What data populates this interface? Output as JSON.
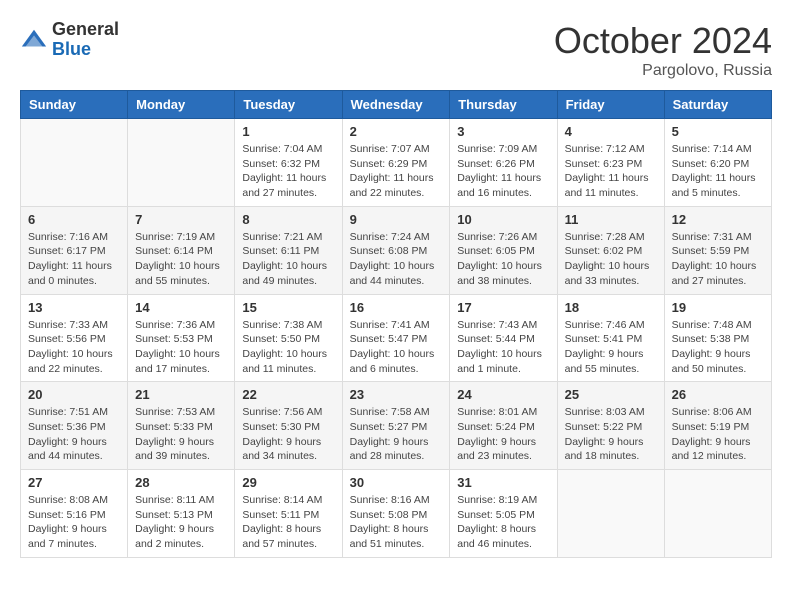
{
  "logo": {
    "general": "General",
    "blue": "Blue"
  },
  "title": {
    "month": "October 2024",
    "location": "Pargolovo, Russia"
  },
  "headers": [
    "Sunday",
    "Monday",
    "Tuesday",
    "Wednesday",
    "Thursday",
    "Friday",
    "Saturday"
  ],
  "weeks": [
    [
      {
        "day": "",
        "sunrise": "",
        "sunset": "",
        "daylight": ""
      },
      {
        "day": "",
        "sunrise": "",
        "sunset": "",
        "daylight": ""
      },
      {
        "day": "1",
        "sunrise": "Sunrise: 7:04 AM",
        "sunset": "Sunset: 6:32 PM",
        "daylight": "Daylight: 11 hours and 27 minutes."
      },
      {
        "day": "2",
        "sunrise": "Sunrise: 7:07 AM",
        "sunset": "Sunset: 6:29 PM",
        "daylight": "Daylight: 11 hours and 22 minutes."
      },
      {
        "day": "3",
        "sunrise": "Sunrise: 7:09 AM",
        "sunset": "Sunset: 6:26 PM",
        "daylight": "Daylight: 11 hours and 16 minutes."
      },
      {
        "day": "4",
        "sunrise": "Sunrise: 7:12 AM",
        "sunset": "Sunset: 6:23 PM",
        "daylight": "Daylight: 11 hours and 11 minutes."
      },
      {
        "day": "5",
        "sunrise": "Sunrise: 7:14 AM",
        "sunset": "Sunset: 6:20 PM",
        "daylight": "Daylight: 11 hours and 5 minutes."
      }
    ],
    [
      {
        "day": "6",
        "sunrise": "Sunrise: 7:16 AM",
        "sunset": "Sunset: 6:17 PM",
        "daylight": "Daylight: 11 hours and 0 minutes."
      },
      {
        "day": "7",
        "sunrise": "Sunrise: 7:19 AM",
        "sunset": "Sunset: 6:14 PM",
        "daylight": "Daylight: 10 hours and 55 minutes."
      },
      {
        "day": "8",
        "sunrise": "Sunrise: 7:21 AM",
        "sunset": "Sunset: 6:11 PM",
        "daylight": "Daylight: 10 hours and 49 minutes."
      },
      {
        "day": "9",
        "sunrise": "Sunrise: 7:24 AM",
        "sunset": "Sunset: 6:08 PM",
        "daylight": "Daylight: 10 hours and 44 minutes."
      },
      {
        "day": "10",
        "sunrise": "Sunrise: 7:26 AM",
        "sunset": "Sunset: 6:05 PM",
        "daylight": "Daylight: 10 hours and 38 minutes."
      },
      {
        "day": "11",
        "sunrise": "Sunrise: 7:28 AM",
        "sunset": "Sunset: 6:02 PM",
        "daylight": "Daylight: 10 hours and 33 minutes."
      },
      {
        "day": "12",
        "sunrise": "Sunrise: 7:31 AM",
        "sunset": "Sunset: 5:59 PM",
        "daylight": "Daylight: 10 hours and 27 minutes."
      }
    ],
    [
      {
        "day": "13",
        "sunrise": "Sunrise: 7:33 AM",
        "sunset": "Sunset: 5:56 PM",
        "daylight": "Daylight: 10 hours and 22 minutes."
      },
      {
        "day": "14",
        "sunrise": "Sunrise: 7:36 AM",
        "sunset": "Sunset: 5:53 PM",
        "daylight": "Daylight: 10 hours and 17 minutes."
      },
      {
        "day": "15",
        "sunrise": "Sunrise: 7:38 AM",
        "sunset": "Sunset: 5:50 PM",
        "daylight": "Daylight: 10 hours and 11 minutes."
      },
      {
        "day": "16",
        "sunrise": "Sunrise: 7:41 AM",
        "sunset": "Sunset: 5:47 PM",
        "daylight": "Daylight: 10 hours and 6 minutes."
      },
      {
        "day": "17",
        "sunrise": "Sunrise: 7:43 AM",
        "sunset": "Sunset: 5:44 PM",
        "daylight": "Daylight: 10 hours and 1 minute."
      },
      {
        "day": "18",
        "sunrise": "Sunrise: 7:46 AM",
        "sunset": "Sunset: 5:41 PM",
        "daylight": "Daylight: 9 hours and 55 minutes."
      },
      {
        "day": "19",
        "sunrise": "Sunrise: 7:48 AM",
        "sunset": "Sunset: 5:38 PM",
        "daylight": "Daylight: 9 hours and 50 minutes."
      }
    ],
    [
      {
        "day": "20",
        "sunrise": "Sunrise: 7:51 AM",
        "sunset": "Sunset: 5:36 PM",
        "daylight": "Daylight: 9 hours and 44 minutes."
      },
      {
        "day": "21",
        "sunrise": "Sunrise: 7:53 AM",
        "sunset": "Sunset: 5:33 PM",
        "daylight": "Daylight: 9 hours and 39 minutes."
      },
      {
        "day": "22",
        "sunrise": "Sunrise: 7:56 AM",
        "sunset": "Sunset: 5:30 PM",
        "daylight": "Daylight: 9 hours and 34 minutes."
      },
      {
        "day": "23",
        "sunrise": "Sunrise: 7:58 AM",
        "sunset": "Sunset: 5:27 PM",
        "daylight": "Daylight: 9 hours and 28 minutes."
      },
      {
        "day": "24",
        "sunrise": "Sunrise: 8:01 AM",
        "sunset": "Sunset: 5:24 PM",
        "daylight": "Daylight: 9 hours and 23 minutes."
      },
      {
        "day": "25",
        "sunrise": "Sunrise: 8:03 AM",
        "sunset": "Sunset: 5:22 PM",
        "daylight": "Daylight: 9 hours and 18 minutes."
      },
      {
        "day": "26",
        "sunrise": "Sunrise: 8:06 AM",
        "sunset": "Sunset: 5:19 PM",
        "daylight": "Daylight: 9 hours and 12 minutes."
      }
    ],
    [
      {
        "day": "27",
        "sunrise": "Sunrise: 8:08 AM",
        "sunset": "Sunset: 5:16 PM",
        "daylight": "Daylight: 9 hours and 7 minutes."
      },
      {
        "day": "28",
        "sunrise": "Sunrise: 8:11 AM",
        "sunset": "Sunset: 5:13 PM",
        "daylight": "Daylight: 9 hours and 2 minutes."
      },
      {
        "day": "29",
        "sunrise": "Sunrise: 8:14 AM",
        "sunset": "Sunset: 5:11 PM",
        "daylight": "Daylight: 8 hours and 57 minutes."
      },
      {
        "day": "30",
        "sunrise": "Sunrise: 8:16 AM",
        "sunset": "Sunset: 5:08 PM",
        "daylight": "Daylight: 8 hours and 51 minutes."
      },
      {
        "day": "31",
        "sunrise": "Sunrise: 8:19 AM",
        "sunset": "Sunset: 5:05 PM",
        "daylight": "Daylight: 8 hours and 46 minutes."
      },
      {
        "day": "",
        "sunrise": "",
        "sunset": "",
        "daylight": ""
      },
      {
        "day": "",
        "sunrise": "",
        "sunset": "",
        "daylight": ""
      }
    ]
  ]
}
